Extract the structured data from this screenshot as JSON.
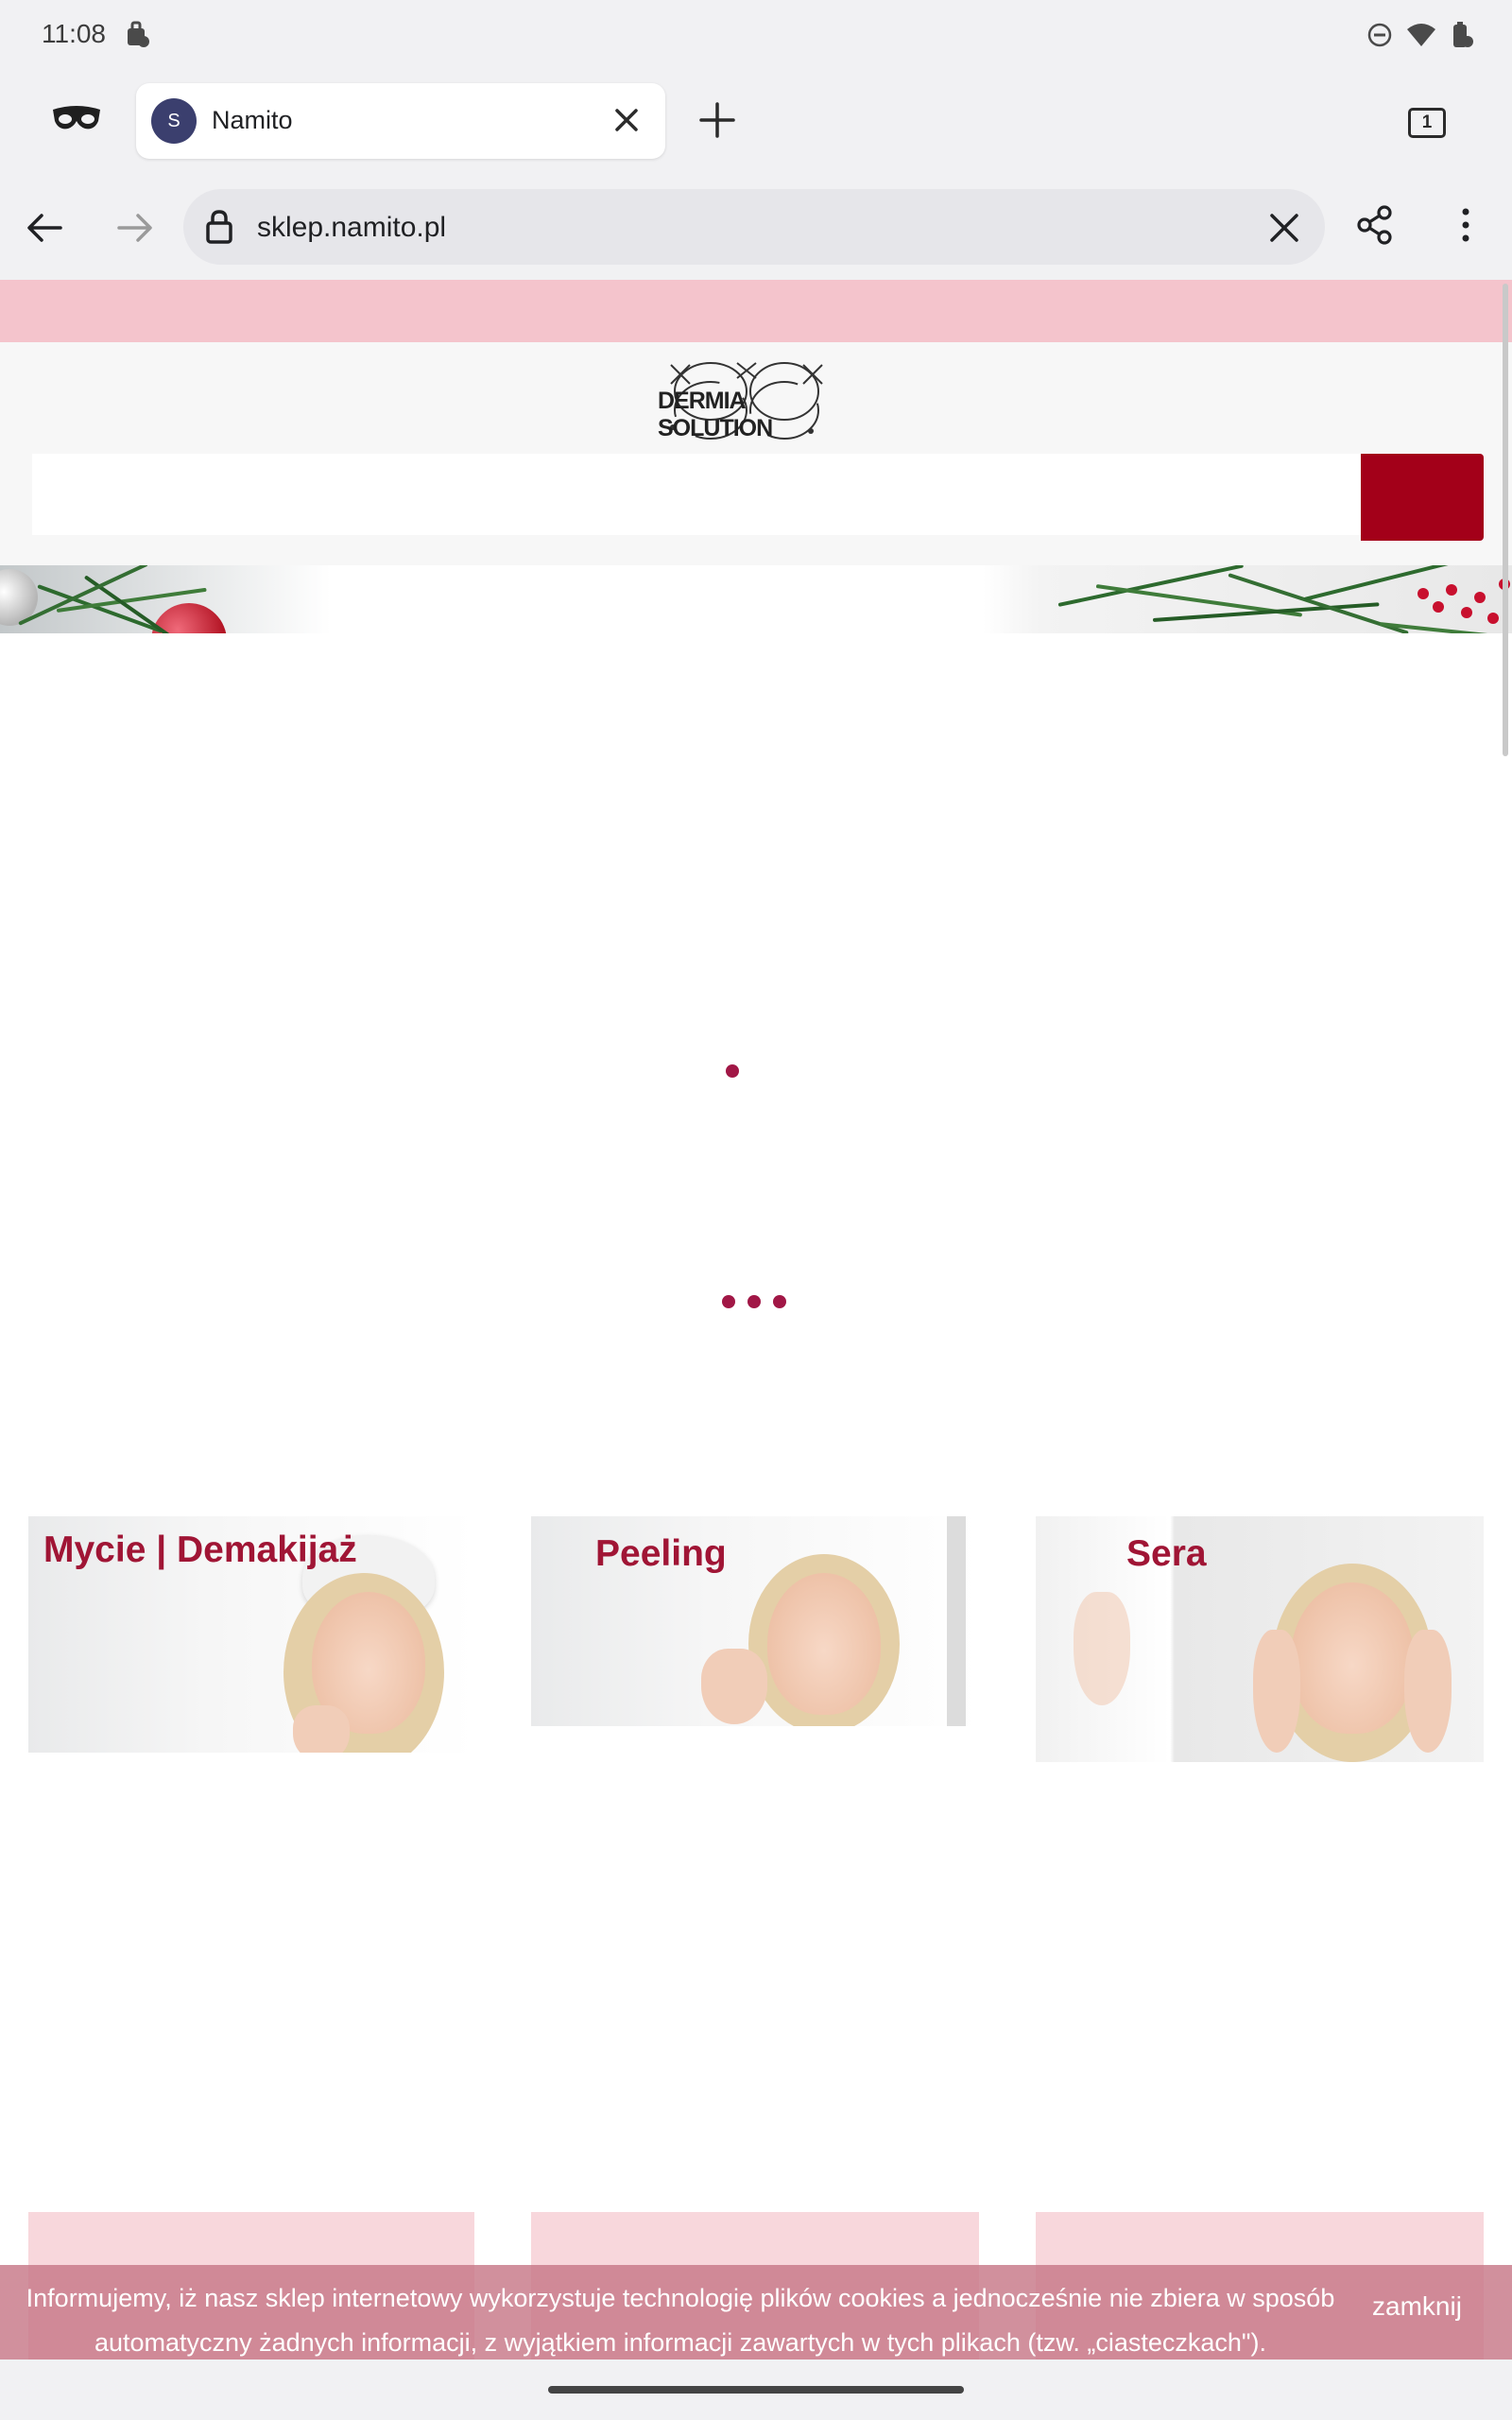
{
  "status_bar": {
    "time": "11:08"
  },
  "browser": {
    "tab": {
      "favicon_letter": "S",
      "title": "Namito"
    },
    "tab_count": "1",
    "url": "sklep.namito.pl"
  },
  "site": {
    "logo_text": "DERMIA SOLUTION",
    "categories": [
      {
        "label": "Mycie | Demakijaż"
      },
      {
        "label": "Peeling"
      },
      {
        "label": "Sera"
      }
    ],
    "cookie": {
      "message": "Informujemy, iż nasz sklep internetowy wykorzystuje technologię plików cookies a jednocześnie nie zbiera w sposób automatyczny żadnych informacji, z wyjątkiem informacji zawartych w tych plikach (tzw. „ciasteczkach\").",
      "close_label": "zamknij"
    }
  },
  "colors": {
    "accent": "#a30019",
    "promo_bar": "#f4c4cc",
    "category_label": "#a01535",
    "loader": "#a11746"
  },
  "icons": [
    "incognito-icon",
    "close-icon",
    "plus-icon",
    "back-arrow-icon",
    "forward-arrow-icon",
    "lock-icon",
    "share-icon",
    "more-vert-icon",
    "wifi-icon",
    "dnd-icon",
    "battery-icon"
  ]
}
